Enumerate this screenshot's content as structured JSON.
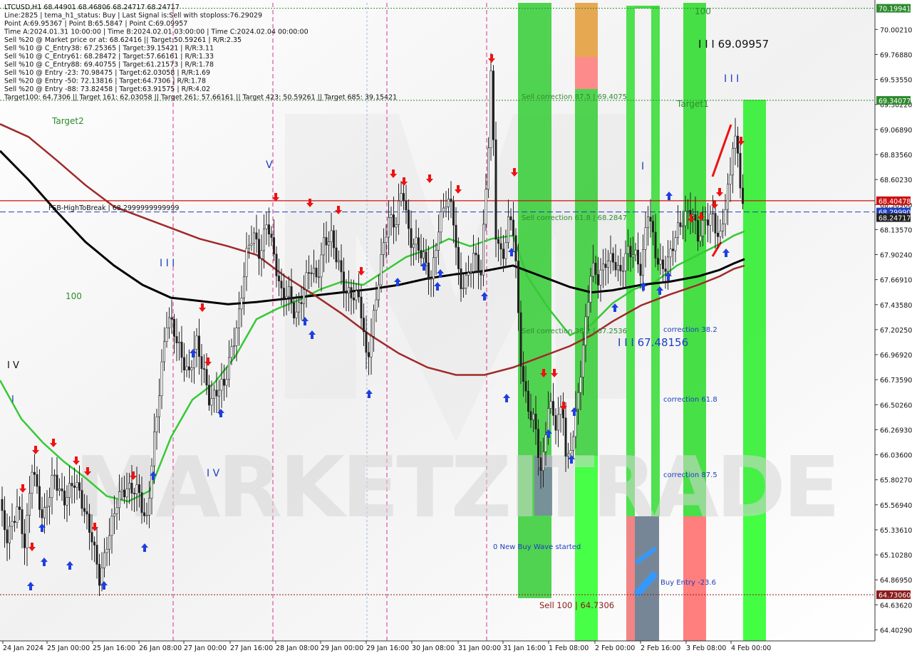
{
  "header": {
    "lines": [
      "LTCUSD,H1  68.44901 68.46806 68.24717 68.24717",
      "Line:2825 | tema_h1_status: Buy | Last Signal is:Sell with stoploss:76.29029",
      "Point A:69.95367 | Point B:65.5847 | Point C:69.09957",
      "Time A:2024.01.31 10:00:00 | Time B:2024.02.01 03:00:00 | Time C:2024.02.04 00:00:00",
      "Sell %20 @ Market price or at: 68.62416 || Target:50.59261 | R/R:2.35",
      "Sell %10 @ C_Entry38: 67.25365 | Target:39.15421 | R/R:3.11",
      "Sell %10 @ C_Entry61: 68.28472 | Target:57.66161 | R/R:1.33",
      "Sell %10 @ C_Entry88: 69.40755 | Target:61.21573 | R/R:1.78",
      "Sell %10 @ Entry -23: 70.98475 | Target:62.03058 | R/R:1.69",
      "Sell %20 @ Entry -50: 72.13816 | Target:64.7306 | R/R:1.78",
      "Sell %20 @ Entry -88: 73.82458 | Target:63.91575 | R/R:4.02",
      "Target100: 64.7306 || Target 161: 62.03058 || Target 261: 57.66161 || Target 423: 50.59261 || Target 685: 39.15421"
    ]
  },
  "watermark": "MARKETZITRADE",
  "chart_data": {
    "type": "candlestick",
    "symbol": "LTCUSD",
    "timeframe": "H1",
    "ylim": [
      64.3,
      70.25
    ],
    "price_ticks": [
      "70.00210",
      "69.76880",
      "69.53550",
      "69.30220",
      "69.06890",
      "68.83560",
      "68.60230",
      "68.36900",
      "68.13570",
      "67.90240",
      "67.66910",
      "67.43580",
      "67.20250",
      "66.96920",
      "66.73590",
      "66.50260",
      "66.26930",
      "66.03600",
      "65.80270",
      "65.56940",
      "65.33610",
      "65.10280",
      "64.86950",
      "64.63620",
      "64.40290"
    ],
    "x_ticks": [
      "24 Jan 2024",
      "25 Jan 00:00",
      "25 Jan 16:00",
      "26 Jan 08:00",
      "27 Jan 00:00",
      "27 Jan 16:00",
      "28 Jan 08:00",
      "29 Jan 00:00",
      "29 Jan 16:00",
      "30 Jan 08:00",
      "31 Jan 00:00",
      "31 Jan 16:00",
      "1 Feb 08:00",
      "2 Feb 00:00",
      "2 Feb 16:00",
      "3 Feb 08:00",
      "4 Feb 00:00"
    ],
    "price_tags": [
      {
        "label": "70.19941",
        "value": 70.19941,
        "color": "#2e8b2e"
      },
      {
        "label": "69.34077",
        "value": 69.34077,
        "color": "#2e8b2e"
      },
      {
        "label": "68.40478",
        "value": 68.40478,
        "color": "#cc1111"
      },
      {
        "label": "68.29990",
        "value": 68.2999,
        "color": "#1f3fbf"
      },
      {
        "label": "68.24717",
        "value": 68.24717,
        "color": "#222222"
      },
      {
        "label": "64.73060",
        "value": 64.7306,
        "color": "#8b1a1a"
      }
    ],
    "levels": [
      {
        "name": "top-green",
        "value": 70.19941,
        "color": "#2e8b2e",
        "style": "dotted"
      },
      {
        "name": "target1",
        "value": 69.34077,
        "color": "#2e8b2e",
        "style": "dotted"
      },
      {
        "name": "resistance",
        "value": 68.40478,
        "color": "#cc1111",
        "style": "solid"
      },
      {
        "name": "fsb-high",
        "value": 68.2999,
        "color": "#1f3fbf",
        "style": "dashed"
      },
      {
        "name": "sell100",
        "value": 64.7306,
        "color": "#8b1a1a",
        "style": "dotted"
      }
    ],
    "annotations": [
      {
        "text": "Target2",
        "color": "#2e8b2e"
      },
      {
        "text": "100",
        "color": "#2e8b2e"
      },
      {
        "text": "100",
        "color": "#2e8b2e"
      },
      {
        "text": "Target1",
        "color": "#2e8b2e"
      },
      {
        "text": "I V",
        "color": "#111111"
      },
      {
        "text": "I",
        "color": "#1f3fbf"
      },
      {
        "text": "I I I",
        "color": "#1f3fbf"
      },
      {
        "text": "V",
        "color": "#1f3fbf"
      },
      {
        "text": "I V",
        "color": "#1f3fbf"
      },
      {
        "text": "I I I",
        "color": "#1f3fbf"
      },
      {
        "text": "I",
        "color": "#1f3fbf"
      },
      {
        "text": "I I I  69.09957",
        "color": "#111111"
      },
      {
        "text": "I I I  67.48156",
        "color": "#1f3fbf"
      },
      {
        "text": "FSB-HighToBreak  |  68.2999999999999",
        "color": "#111111"
      },
      {
        "text": "Sell correction 87.5 | 69.4075",
        "color": "#2e8b2e"
      },
      {
        "text": "Sell correction 61.8 | 68.2847",
        "color": "#2e8b2e"
      },
      {
        "text": "Sell correction 38.2 | 67.2536",
        "color": "#2e8b2e"
      },
      {
        "text": "correction 38.2",
        "color": "#1f3fbf"
      },
      {
        "text": "correction 61.8",
        "color": "#1f3fbf"
      },
      {
        "text": "correction 87.5",
        "color": "#1f3fbf"
      },
      {
        "text": "0 New Buy Wave started",
        "color": "#1f3fbf"
      },
      {
        "text": "Buy Entry -23.6",
        "color": "#1f3fbf"
      },
      {
        "text": "Sell 100 | 64.7306",
        "color": "#8b1a1a"
      }
    ],
    "candle_anchors": [
      [
        0,
        65.62
      ],
      [
        10,
        65.35
      ],
      [
        25,
        65.55
      ],
      [
        35,
        65.1
      ],
      [
        45,
        65.85
      ],
      [
        60,
        65.45
      ],
      [
        75,
        65.95
      ],
      [
        90,
        65.6
      ],
      [
        105,
        65.7
      ],
      [
        120,
        65.45
      ],
      [
        130,
        65.3
      ],
      [
        140,
        64.95
      ],
      [
        150,
        65.25
      ],
      [
        165,
        65.55
      ],
      [
        180,
        65.65
      ],
      [
        195,
        65.75
      ],
      [
        205,
        65.45
      ],
      [
        215,
        66.15
      ],
      [
        225,
        66.7
      ],
      [
        235,
        67.25
      ],
      [
        245,
        67.1
      ],
      [
        255,
        66.95
      ],
      [
        265,
        66.85
      ],
      [
        275,
        67.2
      ],
      [
        285,
        66.85
      ],
      [
        295,
        66.45
      ],
      [
        305,
        66.55
      ],
      [
        315,
        66.65
      ],
      [
        325,
        67.05
      ],
      [
        335,
        67.4
      ],
      [
        345,
        67.95
      ],
      [
        355,
        68.1
      ],
      [
        365,
        67.8
      ],
      [
        375,
        68.15
      ],
      [
        385,
        67.85
      ],
      [
        395,
        67.6
      ],
      [
        405,
        67.65
      ],
      [
        415,
        67.35
      ],
      [
        425,
        67.5
      ],
      [
        435,
        67.7
      ],
      [
        445,
        67.6
      ],
      [
        455,
        68.05
      ],
      [
        465,
        68.15
      ],
      [
        475,
        67.9
      ],
      [
        485,
        67.55
      ],
      [
        495,
        67.45
      ],
      [
        505,
        67.4
      ],
      [
        515,
        66.85
      ],
      [
        525,
        67.4
      ],
      [
        535,
        67.95
      ],
      [
        545,
        68.3
      ],
      [
        555,
        68.15
      ],
      [
        565,
        68.45
      ],
      [
        575,
        67.95
      ],
      [
        585,
        68.0
      ],
      [
        595,
        67.95
      ],
      [
        605,
        67.75
      ],
      [
        615,
        68.15
      ],
      [
        625,
        68.35
      ],
      [
        635,
        68.25
      ],
      [
        645,
        67.55
      ],
      [
        655,
        67.7
      ],
      [
        665,
        68.0
      ],
      [
        675,
        67.8
      ],
      [
        685,
        68.85
      ],
      [
        690,
        69.7
      ],
      [
        695,
        68.05
      ],
      [
        705,
        67.75
      ],
      [
        715,
        68.25
      ],
      [
        722,
        68.15
      ],
      [
        730,
        67.05
      ],
      [
        740,
        66.55
      ],
      [
        750,
        66.35
      ],
      [
        760,
        65.75
      ],
      [
        770,
        66.45
      ],
      [
        780,
        66.3
      ],
      [
        790,
        66.55
      ],
      [
        795,
        66.0
      ],
      [
        800,
        66.15
      ],
      [
        810,
        66.55
      ],
      [
        820,
        67.1
      ],
      [
        830,
        67.7
      ],
      [
        840,
        67.6
      ],
      [
        850,
        67.85
      ],
      [
        860,
        67.95
      ],
      [
        870,
        67.8
      ],
      [
        880,
        67.95
      ],
      [
        890,
        67.85
      ],
      [
        900,
        67.65
      ],
      [
        905,
        68.0
      ],
      [
        910,
        68.3
      ],
      [
        920,
        67.95
      ],
      [
        930,
        67.85
      ],
      [
        940,
        67.95
      ],
      [
        950,
        68.1
      ],
      [
        960,
        68.15
      ],
      [
        970,
        68.25
      ],
      [
        980,
        68.05
      ],
      [
        990,
        68.3
      ],
      [
        1000,
        68.35
      ],
      [
        1010,
        68.05
      ],
      [
        1020,
        68.4
      ],
      [
        1025,
        68.55
      ],
      [
        1030,
        69.0
      ],
      [
        1035,
        68.75
      ],
      [
        1040,
        68.45
      ],
      [
        1046,
        68.25
      ]
    ],
    "indicators": [
      {
        "name": "fast-ma",
        "color": "#36c936",
        "points": [
          [
            0,
            66.73
          ],
          [
            30,
            66.37
          ],
          [
            60,
            66.15
          ],
          [
            90,
            65.97
          ],
          [
            120,
            65.82
          ],
          [
            150,
            65.65
          ],
          [
            180,
            65.6
          ],
          [
            210,
            65.7
          ],
          [
            240,
            66.2
          ],
          [
            270,
            66.55
          ],
          [
            300,
            66.7
          ],
          [
            330,
            66.95
          ],
          [
            360,
            67.3
          ],
          [
            390,
            67.4
          ],
          [
            420,
            67.48
          ],
          [
            450,
            67.58
          ],
          [
            480,
            67.65
          ],
          [
            510,
            67.62
          ],
          [
            540,
            67.75
          ],
          [
            570,
            67.88
          ],
          [
            600,
            67.95
          ],
          [
            630,
            68.05
          ],
          [
            660,
            67.98
          ],
          [
            690,
            68.05
          ],
          [
            720,
            68.08
          ],
          [
            740,
            67.7
          ],
          [
            770,
            67.4
          ],
          [
            800,
            67.15
          ],
          [
            830,
            67.25
          ],
          [
            860,
            67.45
          ],
          [
            890,
            67.58
          ],
          [
            920,
            67.65
          ],
          [
            950,
            67.8
          ],
          [
            980,
            67.9
          ],
          [
            1010,
            68.0
          ],
          [
            1030,
            68.08
          ],
          [
            1045,
            68.12
          ]
        ]
      },
      {
        "name": "slow-ma",
        "color": "#000000",
        "points": [
          [
            0,
            68.87
          ],
          [
            40,
            68.6
          ],
          [
            80,
            68.3
          ],
          [
            120,
            68.02
          ],
          [
            160,
            67.8
          ],
          [
            200,
            67.62
          ],
          [
            240,
            67.5
          ],
          [
            280,
            67.47
          ],
          [
            320,
            67.44
          ],
          [
            360,
            67.46
          ],
          [
            400,
            67.49
          ],
          [
            440,
            67.52
          ],
          [
            480,
            67.55
          ],
          [
            520,
            67.58
          ],
          [
            560,
            67.62
          ],
          [
            600,
            67.68
          ],
          [
            640,
            67.72
          ],
          [
            680,
            67.75
          ],
          [
            720,
            67.8
          ],
          [
            760,
            67.7
          ],
          [
            800,
            67.6
          ],
          [
            830,
            67.55
          ],
          [
            860,
            67.57
          ],
          [
            900,
            67.62
          ],
          [
            940,
            67.65
          ],
          [
            980,
            67.7
          ],
          [
            1010,
            67.76
          ],
          [
            1030,
            67.82
          ],
          [
            1045,
            67.86
          ]
        ]
      },
      {
        "name": "red-ma",
        "color": "#a02a2a",
        "points": [
          [
            0,
            69.12
          ],
          [
            40,
            69.0
          ],
          [
            80,
            68.78
          ],
          [
            120,
            68.55
          ],
          [
            160,
            68.35
          ],
          [
            200,
            68.25
          ],
          [
            240,
            68.15
          ],
          [
            280,
            68.05
          ],
          [
            320,
            67.98
          ],
          [
            360,
            67.9
          ],
          [
            400,
            67.7
          ],
          [
            440,
            67.53
          ],
          [
            480,
            67.35
          ],
          [
            520,
            67.15
          ],
          [
            560,
            66.98
          ],
          [
            600,
            66.85
          ],
          [
            640,
            66.78
          ],
          [
            680,
            66.78
          ],
          [
            720,
            66.85
          ],
          [
            760,
            66.95
          ],
          [
            800,
            67.05
          ],
          [
            830,
            67.15
          ],
          [
            860,
            67.28
          ],
          [
            900,
            67.43
          ],
          [
            940,
            67.53
          ],
          [
            980,
            67.62
          ],
          [
            1010,
            67.7
          ],
          [
            1030,
            67.77
          ],
          [
            1045,
            67.8
          ]
        ]
      }
    ]
  }
}
